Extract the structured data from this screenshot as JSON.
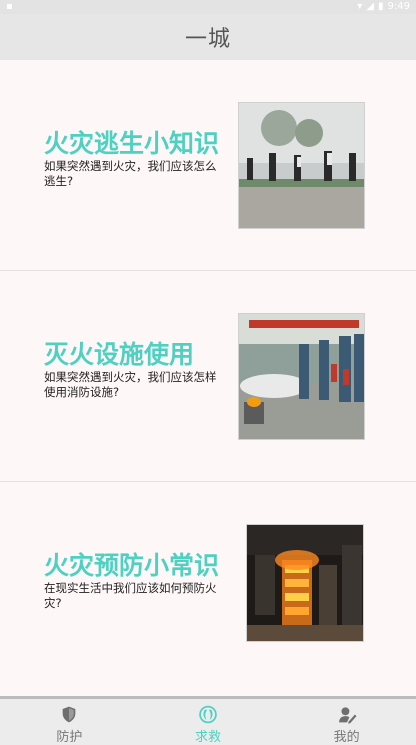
{
  "status_bar": {
    "time": "9:49"
  },
  "app_bar": {
    "title": "一城"
  },
  "cards": [
    {
      "title": "火灾逃生小知识",
      "desc": "如果突然遇到火灾，我们应该怎么逃生?"
    },
    {
      "title": "灭火设施使用",
      "desc": "如果突然遇到火灾，我们应该怎样使用消防设施?"
    },
    {
      "title": "火灾预防小常识",
      "desc": "在现实生活中我们应该如何预防火灾?"
    }
  ],
  "bottom_nav": {
    "items": [
      {
        "label": "防护",
        "icon": "shield-icon",
        "active": false
      },
      {
        "label": "求救",
        "icon": "help-icon",
        "active": true
      },
      {
        "label": "我的",
        "icon": "profile-edit-icon",
        "active": false
      }
    ]
  },
  "colors": {
    "accent": "#4fd1c1",
    "bar": "#e6e6e6",
    "background": "#fdf7f8"
  }
}
